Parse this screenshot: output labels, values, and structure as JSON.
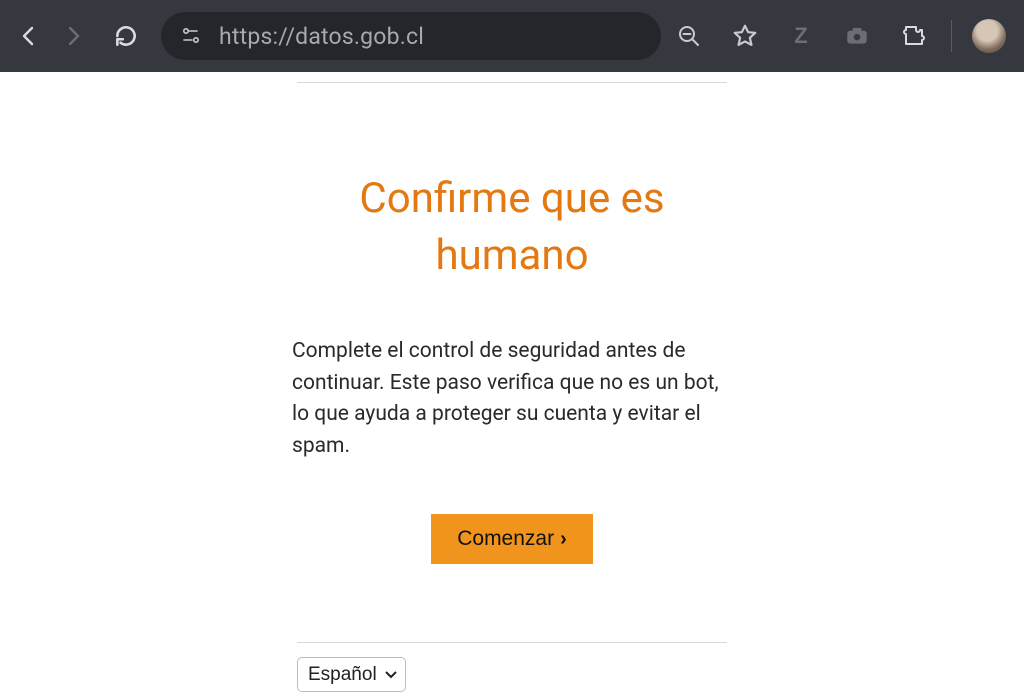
{
  "browser": {
    "url": "https://datos.gob.cl"
  },
  "page": {
    "headline": "Confirme que es humano",
    "description": "Complete el control de seguridad antes de continuar. Este paso verifica que no es un bot, lo que ayuda a proteger su cuenta y evitar el spam.",
    "begin_label": "Comenzar",
    "language_selected": "Español"
  }
}
